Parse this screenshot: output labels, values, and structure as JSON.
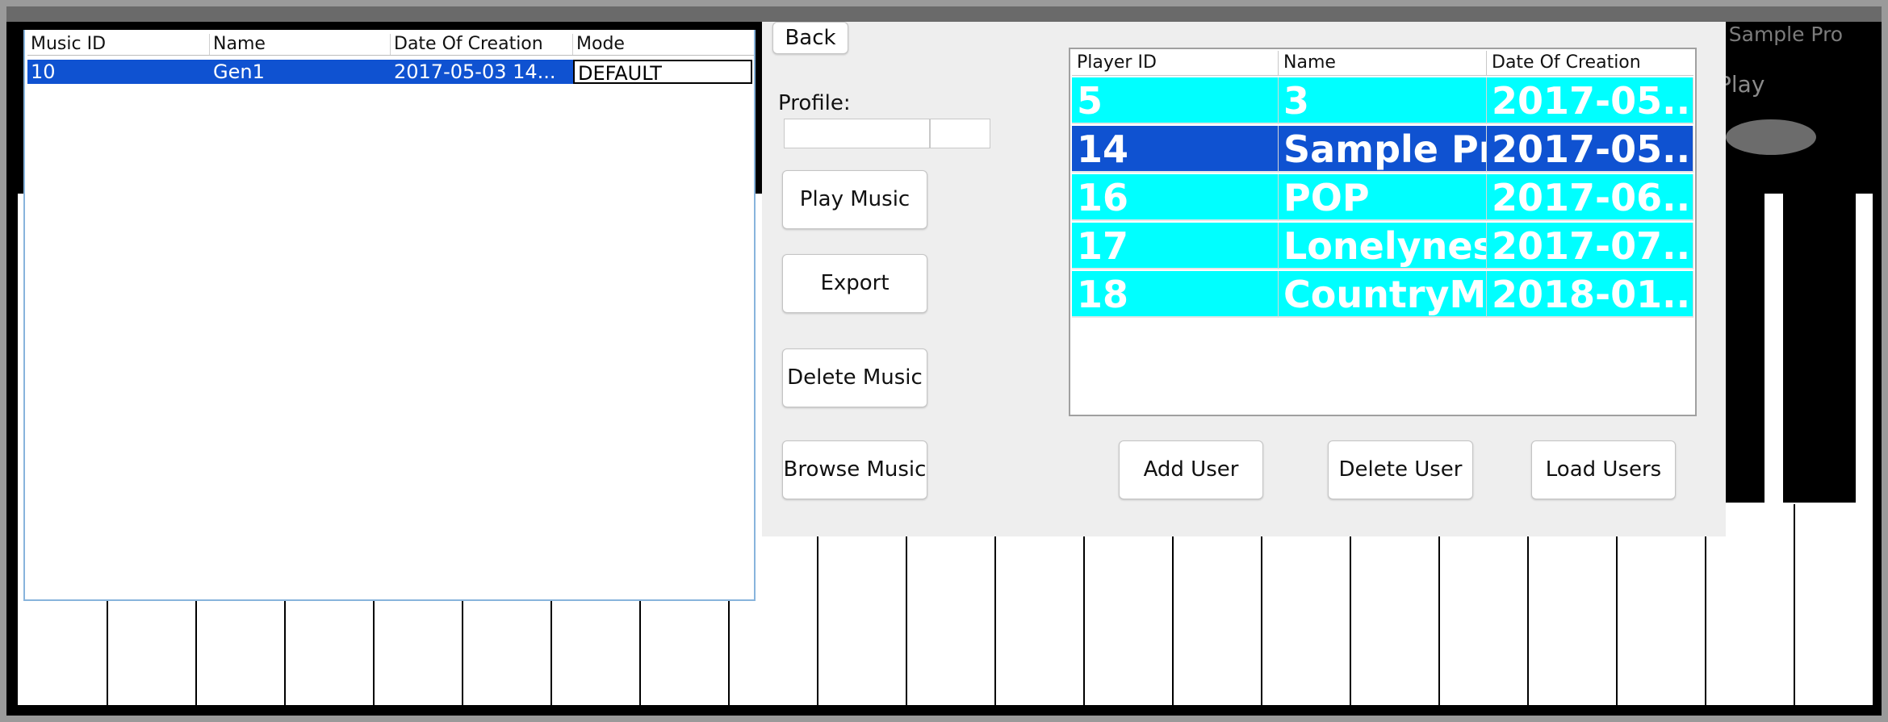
{
  "header": {
    "title_fragment": "e: Sample Pro"
  },
  "background_play": {
    "label": "Play"
  },
  "music_table": {
    "columns": [
      "Music ID",
      "Name",
      "Date Of Creation",
      "Mode"
    ],
    "rows": [
      {
        "id": "10",
        "name": "Gen1",
        "date": "2017-05-03 14...",
        "mode": "DEFAULT"
      }
    ]
  },
  "dialog": {
    "back_label": "Back",
    "profile_label": "Profile:",
    "profile_value": "",
    "play_music_label": "Play Music",
    "export_label": "Export",
    "delete_music_label": "Delete Music",
    "browse_music_label": "Browse Music",
    "add_user_label": "Add User",
    "delete_user_label": "Delete User",
    "load_users_label": "Load Users"
  },
  "users_table": {
    "columns": [
      "Player ID",
      "Name",
      "Date Of Creation"
    ],
    "rows": [
      {
        "id": "5",
        "name": "3",
        "date": "2017-05...",
        "selected": false
      },
      {
        "id": "14",
        "name": "Sample Pro",
        "date": "2017-05...",
        "selected": true
      },
      {
        "id": "16",
        "name": "POP",
        "date": "2017-06...",
        "selected": false
      },
      {
        "id": "17",
        "name": "Lonelyness",
        "date": "2017-07...",
        "selected": false
      },
      {
        "id": "18",
        "name": "CountryM...",
        "date": "2018-01...",
        "selected": false
      }
    ]
  },
  "colors": {
    "selection_blue": "#0f52d1",
    "row_cyan": "#00ffff",
    "dialog_bg": "#eeeeee"
  }
}
